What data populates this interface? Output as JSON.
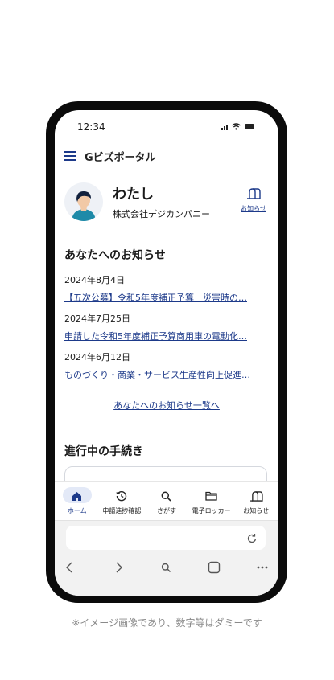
{
  "status_bar": {
    "time": "12:34"
  },
  "app": {
    "title": "Gビズポータル"
  },
  "profile": {
    "name": "わたし",
    "company": "株式会社デジカンパニー",
    "notice_label": "お知らせ"
  },
  "notices": {
    "heading": "あなたへのお知らせ",
    "items": [
      {
        "date": "2024年8月4日",
        "title": "【五次公募】令和5年度補正予算　災害時の…"
      },
      {
        "date": "2024年7月25日",
        "title": "申請した令和5年度補正予算商用車の電動化…"
      },
      {
        "date": "2024年6月12日",
        "title": "ものづくり・商業・サービス生産性向上促進…"
      }
    ],
    "more_link": "あなたへのお知らせ一覧へ"
  },
  "procedures": {
    "heading": "進行中の手続き"
  },
  "tabbar": {
    "items": [
      {
        "label": "ホーム",
        "icon": "home-icon",
        "active": true
      },
      {
        "label": "申請進捗確認",
        "icon": "history-icon"
      },
      {
        "label": "さがす",
        "icon": "search-icon"
      },
      {
        "label": "電子ロッカー",
        "icon": "folder-icon"
      },
      {
        "label": "お知らせ",
        "icon": "mailbox-icon"
      }
    ]
  },
  "colors": {
    "accent": "#1d3a8a",
    "tab_active_bg": "#e3e9f7",
    "frame": "#0b0b0b"
  },
  "caption": "※イメージ画像であり、数字等はダミーです"
}
